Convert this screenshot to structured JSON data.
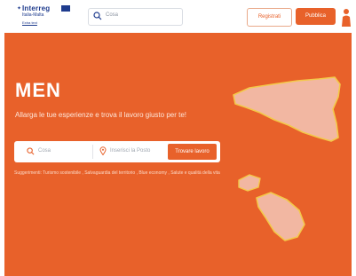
{
  "header": {
    "logo_line1": "Interreg",
    "logo_line2": "Italia-Malta",
    "logo_line3": "Extra text",
    "search_placeholder": "Cosa",
    "register_label": "Registrati",
    "publish_label": "Pubblica"
  },
  "hero": {
    "title": "MEN",
    "subtitle": "Allarga le tue esperienze e trova il lavoro giusto per te!",
    "search": {
      "what_placeholder": "Cosa",
      "where_placeholder": "Inserisci la Posto",
      "button_label": "Trovare lavoro"
    },
    "suggestions": "Suggerimenti: Turismo sostenibile , Salvaguardia del territorio , Blue economy , Salute e qualità della vita"
  },
  "colors": {
    "accent": "#e8612a",
    "brand_blue": "#1f3c8e",
    "map_fill": "#f2b7a2",
    "map_outline": "#f3c94a"
  },
  "icons": {
    "header_search": "search-icon",
    "hero_search": "search-icon",
    "location": "location-pin-icon",
    "account": "person-icon"
  }
}
